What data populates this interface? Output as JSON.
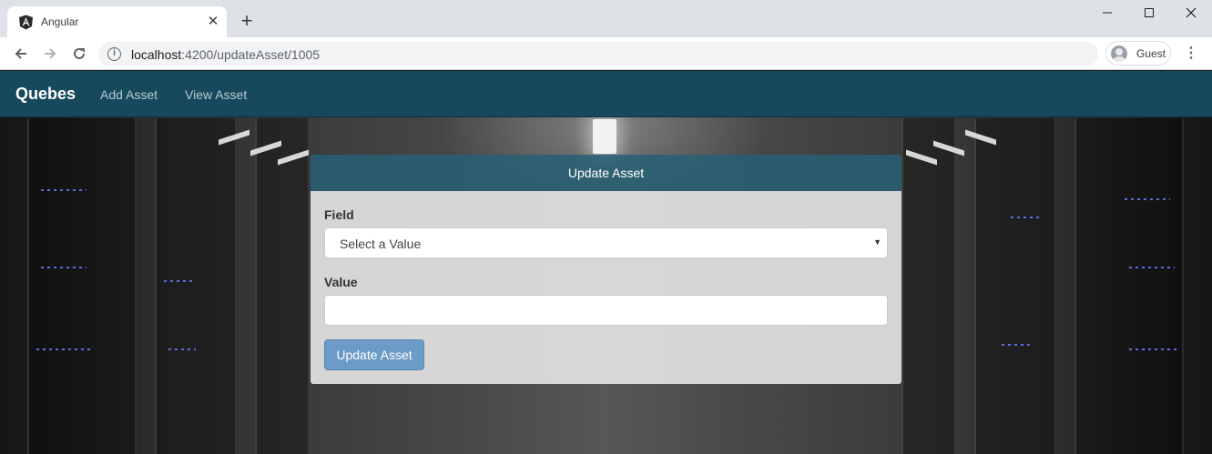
{
  "browser": {
    "tab": {
      "title": "Angular",
      "favicon": "angular-icon",
      "close_glyph": "✕"
    },
    "new_tab_glyph": "+",
    "window_controls": {
      "minimize": "—",
      "maximize": "☐",
      "close": "✕"
    },
    "nav": {
      "back": "back-arrow-icon",
      "forward": "forward-arrow-icon",
      "reload": "reload-icon"
    },
    "address": {
      "info_glyph": "i",
      "host": "localhost",
      "path": ":4200/updateAsset/1005"
    },
    "profile": {
      "label": "Guest"
    },
    "menu_glyph": "⋮"
  },
  "navbar": {
    "brand": "Quebes",
    "links": [
      "Add Asset",
      "View Asset"
    ],
    "background": "#16495c"
  },
  "form": {
    "title": "Update Asset",
    "field_label": "Field",
    "select_value": "Select a Value",
    "select_caret": "▼",
    "value_label": "Value",
    "value_input": "",
    "submit_label": "Update Asset",
    "submit_color": "#6b9bc6"
  }
}
